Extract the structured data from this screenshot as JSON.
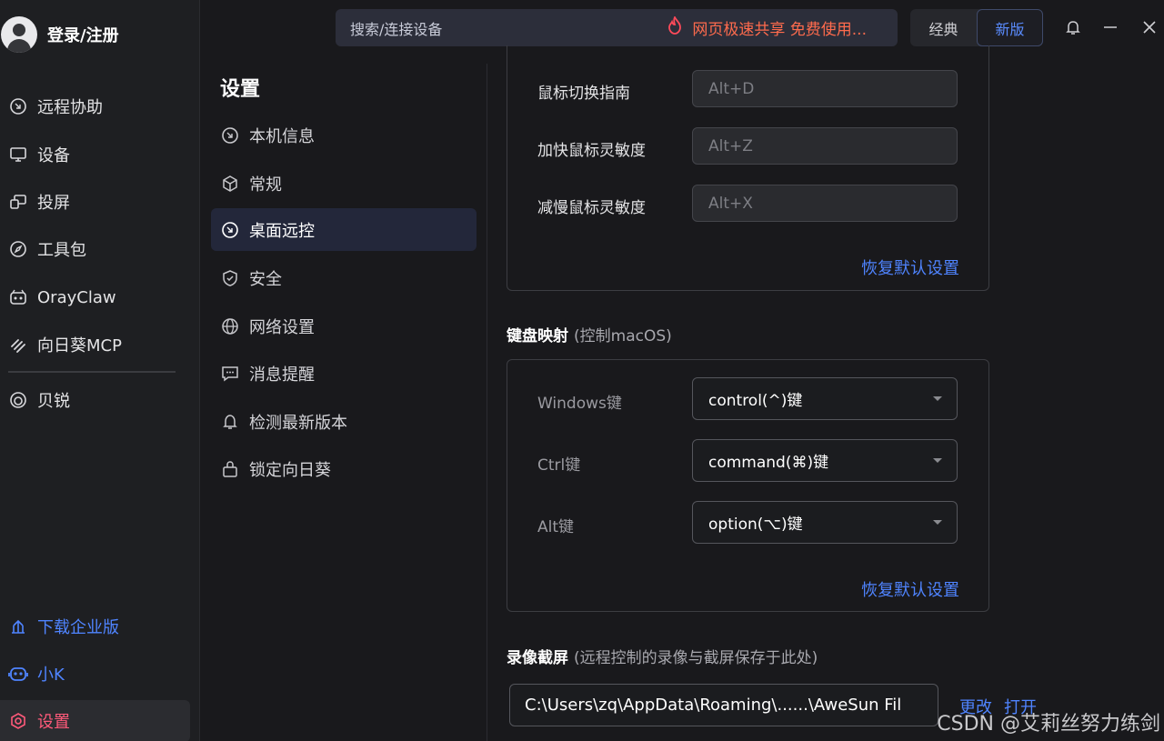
{
  "user": {
    "login_label": "登录/注册"
  },
  "nav": {
    "items": [
      {
        "label": "远程协助",
        "icon": "remote-assist-icon"
      },
      {
        "label": "设备",
        "icon": "device-icon"
      },
      {
        "label": "投屏",
        "icon": "cast-icon"
      },
      {
        "label": "工具包",
        "icon": "toolbox-icon"
      },
      {
        "label": "OrayClaw",
        "icon": "orayclaw-icon"
      },
      {
        "label": "向日葵MCP",
        "icon": "mcp-icon"
      },
      {
        "label": "贝锐",
        "icon": "oray-icon"
      }
    ],
    "bottom": [
      {
        "label": "下载企业版",
        "icon": "enterprise-icon"
      },
      {
        "label": "小K",
        "icon": "robot-icon"
      },
      {
        "label": "设置",
        "icon": "settings-icon"
      }
    ]
  },
  "topbar": {
    "search_label": "搜索/连接设备",
    "promo": "网页极速共享 免费使用...",
    "version_classic": "经典",
    "version_new": "新版"
  },
  "settings": {
    "title": "设置",
    "menu": [
      {
        "label": "本机信息",
        "icon": "device-info-icon"
      },
      {
        "label": "常规",
        "icon": "cube-icon"
      },
      {
        "label": "桌面远控",
        "icon": "remote-desktop-icon"
      },
      {
        "label": "安全",
        "icon": "shield-icon"
      },
      {
        "label": "网络设置",
        "icon": "globe-icon"
      },
      {
        "label": "消息提醒",
        "icon": "message-icon"
      },
      {
        "label": "检测最新版本",
        "icon": "bell-icon"
      },
      {
        "label": "锁定向日葵",
        "icon": "lock-icon"
      }
    ]
  },
  "hotkeys": {
    "rows": [
      {
        "label": "鼠标切换指南",
        "value": "Alt+D"
      },
      {
        "label": "加快鼠标灵敏度",
        "value": "Alt+Z"
      },
      {
        "label": "减慢鼠标灵敏度",
        "value": "Alt+X"
      }
    ],
    "restore": "恢复默认设置"
  },
  "keymap": {
    "title": "键盘映射",
    "subtitle": "(控制macOS)",
    "rows": [
      {
        "label": "Windows键",
        "value": "control(^)键"
      },
      {
        "label": "Ctrl键",
        "value": "command(⌘)键"
      },
      {
        "label": "Alt键",
        "value": "option(⌥)键"
      }
    ],
    "restore": "恢复默认设置"
  },
  "recording": {
    "title": "录像截屏",
    "subtitle": "(远程控制的录像与截屏保存于此处)",
    "path": "C:\\Users\\zq\\AppData\\Roaming\\......\\AweSun Fil",
    "change": "更改",
    "open": "打开"
  },
  "watermark": "CSDN @艾莉丝努力练剑",
  "colors": {
    "accent_blue": "#4f84ff",
    "active_pink": "#ff5a7a",
    "promo_orange": "#ff6b4d"
  }
}
